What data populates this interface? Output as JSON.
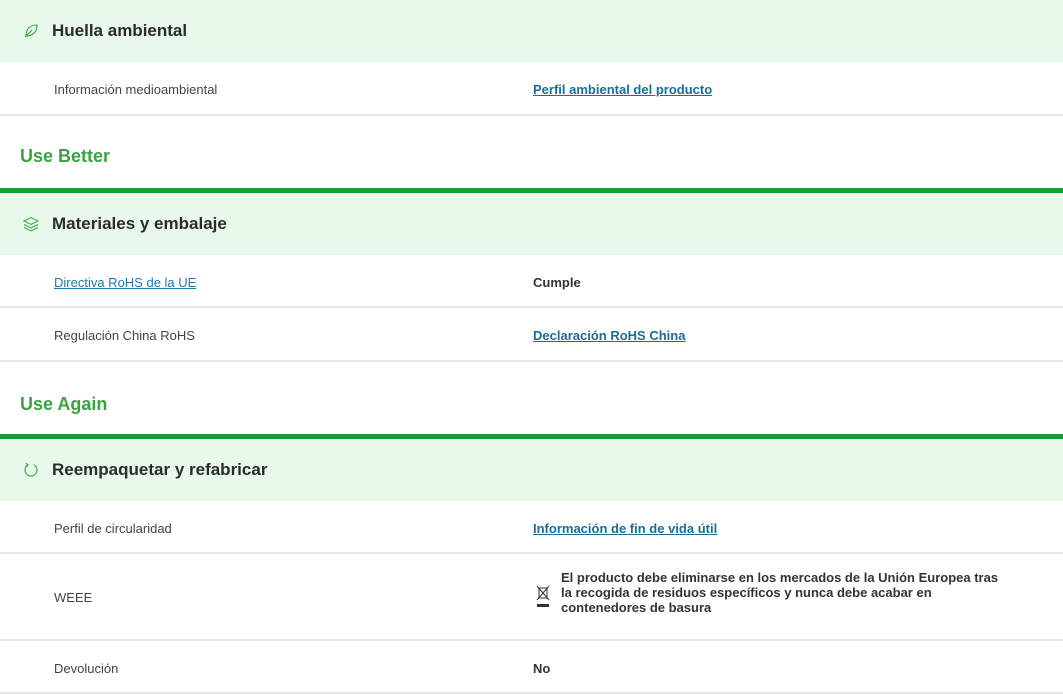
{
  "environmental_footprint": {
    "title": "Huella ambiental",
    "icon": "leaf-icon",
    "rows": [
      {
        "label": "Información medioambiental",
        "value": "Perfil ambiental del producto"
      }
    ]
  },
  "use_better": {
    "section_title": "Use Better",
    "title": "Materiales y embalaje",
    "icon": "layers-icon",
    "rows": [
      {
        "label": "Directiva RoHS de la UE",
        "value": "Cumple"
      },
      {
        "label": "Regulación China RoHS",
        "value": "Declaración RoHS China"
      }
    ]
  },
  "use_again": {
    "section_title": "Use Again",
    "title": "Reempaquetar y refabricar",
    "icon": "circular-arrow-icon",
    "rows": [
      {
        "label": "Perfil de circularidad",
        "value": "Información de fin de vida útil"
      },
      {
        "label": "WEEE",
        "value": "El producto debe eliminarse en los mercados de la Unión Europea tras la recogida de residuos específicos y nunca debe acabar en contenedores de basura",
        "icon": "crossed-out-bin-icon"
      },
      {
        "label": "Devolución",
        "value": "No"
      }
    ]
  },
  "colors": {
    "section_title": "#3ba344",
    "bar": "#1f9a2e",
    "header_bg": "#e8f8ea",
    "link": "#1c6d96"
  }
}
